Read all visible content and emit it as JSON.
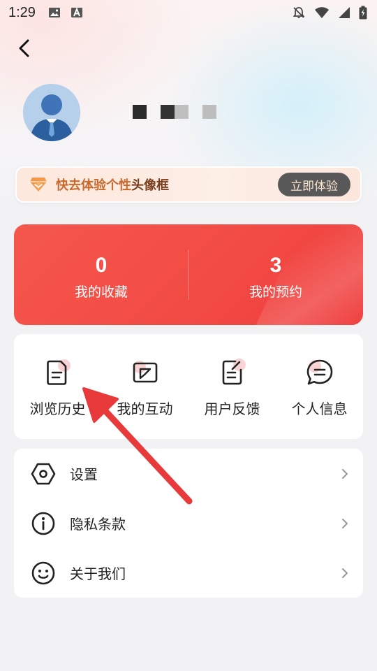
{
  "status_bar": {
    "time": "1:29"
  },
  "profile": {
    "avatar_icon": "avatar-icon"
  },
  "promo": {
    "text_prefix": "快去体验个性",
    "text_highlight": "头像框",
    "button_label": "立即体验",
    "colors": {
      "text": "#c86a2e",
      "button_bg": "#585858"
    }
  },
  "stats": [
    {
      "value": "0",
      "label": "我的收藏"
    },
    {
      "value": "3",
      "label": "我的预约"
    }
  ],
  "grid": [
    {
      "label": "浏览历史",
      "icon": "history-doc-icon"
    },
    {
      "label": "我的互动",
      "icon": "interaction-icon"
    },
    {
      "label": "用户反馈",
      "icon": "feedback-icon"
    },
    {
      "label": "个人信息",
      "icon": "chat-info-icon"
    }
  ],
  "menu": [
    {
      "label": "设置",
      "icon": "settings-hexagon-icon"
    },
    {
      "label": "隐私条款",
      "icon": "info-circle-icon"
    },
    {
      "label": "关于我们",
      "icon": "smile-icon"
    }
  ],
  "colors": {
    "accent_red": "#f24a44",
    "annotation_arrow": "#e8393b"
  }
}
